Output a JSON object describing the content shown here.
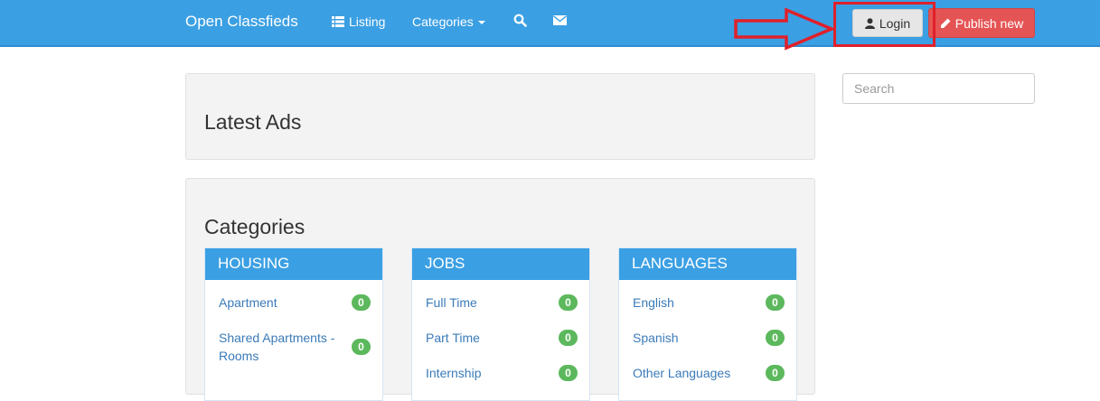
{
  "navbar": {
    "brand": "Open Classfieds",
    "listing_label": "Listing",
    "categories_label": "Categories",
    "search_icon": "search-icon",
    "mail_icon": "envelope-icon",
    "login_label": "Login",
    "publish_label": "Publish new",
    "colors": {
      "navbar": "#3b9fe3",
      "publish": "#e55454",
      "annotation": "#e0202a"
    }
  },
  "search": {
    "placeholder": "Search"
  },
  "main": {
    "latest_title": "Latest Ads",
    "categories_title": "Categories",
    "cards": [
      {
        "title": "HOUSING",
        "items": [
          {
            "label": "Apartment",
            "count": "0"
          },
          {
            "label": "Shared Apartments - Rooms",
            "count": "0"
          }
        ]
      },
      {
        "title": "JOBS",
        "items": [
          {
            "label": "Full Time",
            "count": "0"
          },
          {
            "label": "Part Time",
            "count": "0"
          },
          {
            "label": "Internship",
            "count": "0"
          }
        ]
      },
      {
        "title": "LANGUAGES",
        "items": [
          {
            "label": "English",
            "count": "0"
          },
          {
            "label": "Spanish",
            "count": "0"
          },
          {
            "label": "Other Languages",
            "count": "0"
          }
        ]
      }
    ]
  }
}
